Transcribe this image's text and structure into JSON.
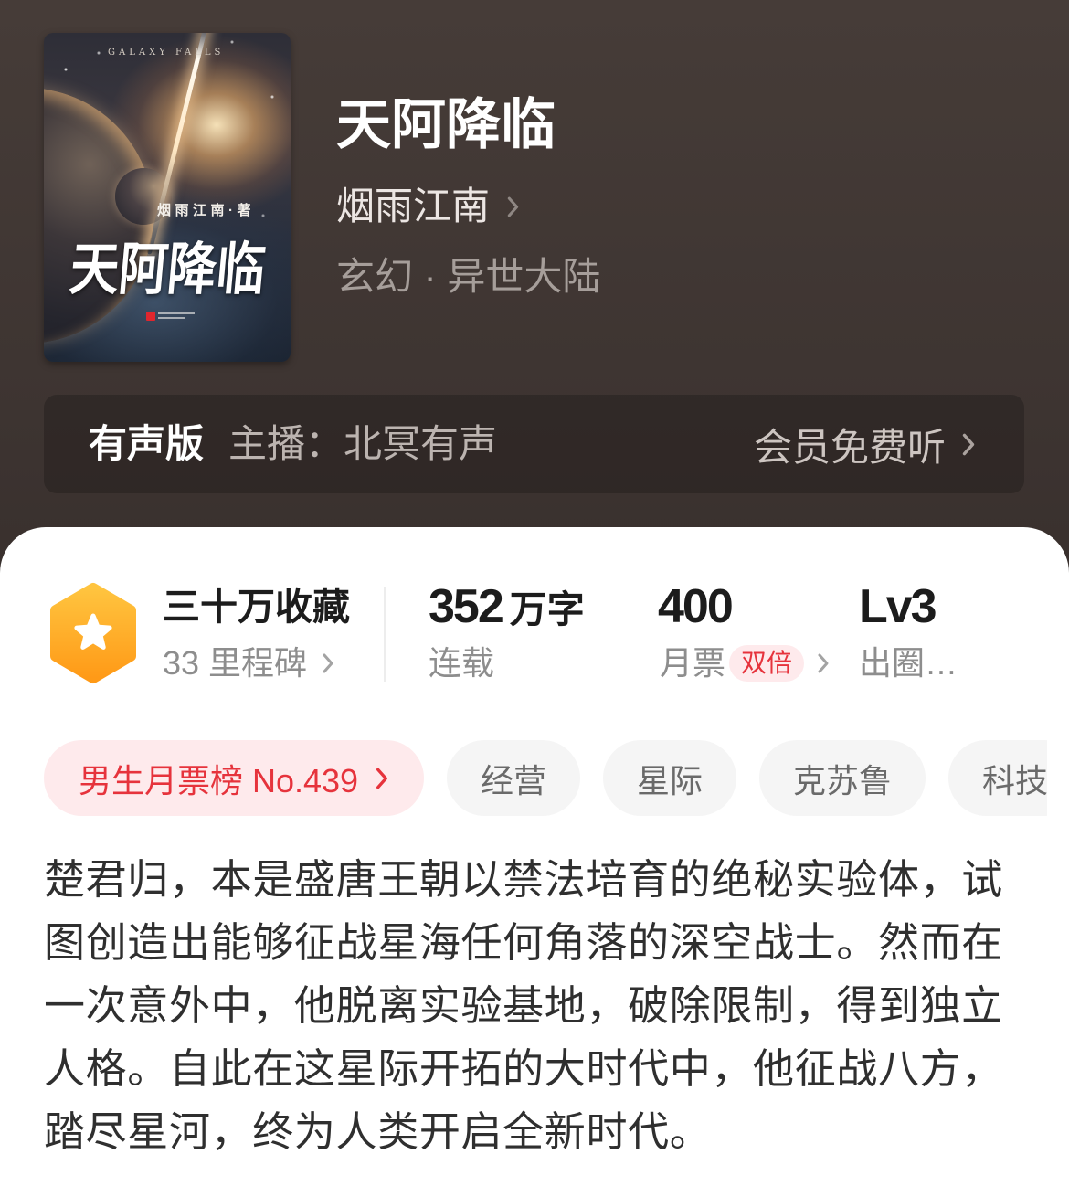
{
  "book": {
    "cover": {
      "series_text": "GALAXY FALLS",
      "author_line": "烟雨江南·著",
      "title": "天阿降临"
    },
    "title": "天阿降临",
    "author": "烟雨江南",
    "genre": "玄幻 · 异世大陆"
  },
  "audio": {
    "label": "有声版",
    "narrator_label": "主播：",
    "narrator": "北冥有声",
    "action": "会员免费听"
  },
  "stats": {
    "collections": {
      "value": "三十万收藏",
      "sub": "33 里程碑"
    },
    "words": {
      "value": "352",
      "unit": "万字",
      "sub": "连载"
    },
    "monthly_tickets": {
      "value": "400",
      "sub": "月票",
      "badge": "双倍"
    },
    "level": {
      "value": "Lv3",
      "sub": "出圈…"
    }
  },
  "tags": [
    {
      "label": "男生月票榜 No.439"
    },
    {
      "label": "经营"
    },
    {
      "label": "星际"
    },
    {
      "label": "克苏鲁"
    },
    {
      "label": "科技"
    }
  ],
  "description": "楚君归，本是盛唐王朝以禁法培育的绝秘实验体，试图创造出能够征战星海任何角落的深空战士。然而在一次意外中，他脱离实验基地，破除限制，得到独立人格。自此在这星际开拓的大时代中，他征战八方，踏尽星河，终为人类开启全新时代。",
  "icons": {
    "milestone": "star-hexagon-icon",
    "more": "chevron-right-icon"
  },
  "colors": {
    "header_background": "#2b2321",
    "accent_red": "#e6333c",
    "accent_red_background": "#feeaec",
    "milestone_orange": "#ffa21f",
    "tag_background": "#f5f5f5",
    "text_primary": "#1c1c1c",
    "text_secondary": "#8d8d8d"
  }
}
